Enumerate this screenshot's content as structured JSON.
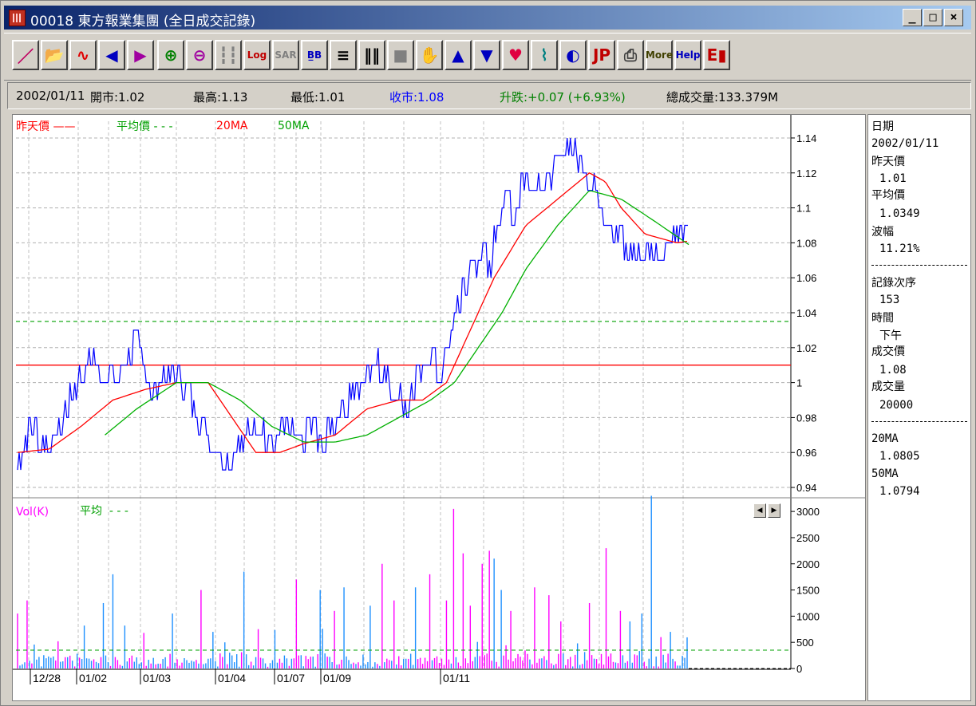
{
  "window": {
    "title": "00018 東方報業集團 (全日成交記錄)",
    "min_label": "_",
    "max_label": "□",
    "close_label": "×"
  },
  "toolbar": {
    "buttons": [
      {
        "name": "draw-line-icon",
        "glyph": "／",
        "color": "#c00060"
      },
      {
        "name": "open-folder-icon",
        "glyph": "📂",
        "color": "#c08000"
      },
      {
        "name": "wave-icon",
        "glyph": "∿",
        "color": "#e00000"
      },
      {
        "name": "arrow-left-icon",
        "glyph": "◀",
        "color": "#0000c0"
      },
      {
        "name": "arrow-right-icon",
        "glyph": "▶",
        "color": "#a000a0"
      },
      {
        "name": "zoom-in-icon",
        "glyph": "⊕",
        "color": "#008000"
      },
      {
        "name": "zoom-out-icon",
        "glyph": "⊖",
        "color": "#a000a0"
      },
      {
        "name": "candlestick-icon",
        "glyph": "┇┇",
        "color": "#808080"
      },
      {
        "name": "log-icon",
        "glyph": "Log",
        "color": "#c00000"
      },
      {
        "name": "sar-icon",
        "glyph": "SAR",
        "color": "#808080"
      },
      {
        "name": "bb-icon",
        "glyph": "B̲B",
        "color": "#0000c0"
      },
      {
        "name": "horizontal-grid-icon",
        "glyph": "≡",
        "color": "#000000"
      },
      {
        "name": "vertical-grid-icon",
        "glyph": "‖‖",
        "color": "#000000"
      },
      {
        "name": "fill-square-icon",
        "glyph": "■",
        "color": "#808080"
      },
      {
        "name": "hand-icon",
        "glyph": "✋",
        "color": "#404040"
      },
      {
        "name": "arrow-up-icon",
        "glyph": "▲",
        "color": "#0000c0"
      },
      {
        "name": "arrow-down-icon",
        "glyph": "▼",
        "color": "#0000c0"
      },
      {
        "name": "favorite-folder-icon",
        "glyph": "♥",
        "color": "#e00040"
      },
      {
        "name": "indicator-chart-icon",
        "glyph": "⌇",
        "color": "#008080"
      },
      {
        "name": "color-palette-icon",
        "glyph": "◐",
        "color": "#0000c0"
      },
      {
        "name": "save-jp-icon",
        "glyph": "JP",
        "color": "#c00000"
      },
      {
        "name": "print-icon",
        "glyph": "⎙",
        "color": "#404040"
      },
      {
        "name": "more-icon",
        "glyph": "More",
        "color": "#404000"
      },
      {
        "name": "help-icon",
        "glyph": "Help",
        "color": "#0000c0"
      },
      {
        "name": "exit-door-icon",
        "glyph": "E▮",
        "color": "#c00000"
      }
    ]
  },
  "info": {
    "date": "2002/01/11",
    "open": "開市:1.02",
    "high": "最高:1.13",
    "low": "最低:1.01",
    "close": "收市:1.08",
    "change": "升跌:+0.07 (+6.93%)",
    "volume": "總成交量:133.379M",
    "colors": {
      "close": "#0000ff",
      "change": "#008000"
    }
  },
  "legend": {
    "prev_price": "昨天價",
    "avg_price": "平均價",
    "ma20": "20MA",
    "ma50": "50MA",
    "vol_label": "Vol(K)",
    "vol_avg": "平均"
  },
  "side": {
    "date_label": "日期",
    "date_value": "2002/01/11",
    "prev_label": "昨天價",
    "prev_value": "1.01",
    "avg_label": "平均價",
    "avg_value": "1.0349",
    "amp_label": "波幅",
    "amp_value": "11.21%",
    "seq_label": "記錄次序",
    "seq_value": "153",
    "time_label": "時間",
    "time_value": "下午",
    "price_label": "成交價",
    "price_value": "1.08",
    "vol_label": "成交量",
    "vol_value": "20000",
    "ma20_label": "20MA",
    "ma20_value": "1.0805",
    "ma50_label": "50MA",
    "ma50_value": "1.0794"
  },
  "chart_data": [
    {
      "type": "line",
      "y_ticks": [
        "1.14",
        "1.12",
        "1.1",
        "1.08",
        "1.06",
        "1.04",
        "1.02",
        "1",
        "0.98",
        "0.96",
        "0.94"
      ],
      "ylim": [
        0.935,
        1.145
      ],
      "x_tick_labels": [
        "12/28",
        "01/02",
        "01/03",
        "01/04",
        "01/07",
        "01/09",
        "01/11"
      ],
      "prev_close": 1.01,
      "average": 1.035,
      "series": [
        {
          "name": "昨天價",
          "color": "#ff0000"
        },
        {
          "name": "平均價",
          "color": "#00a000"
        },
        {
          "name": "20MA",
          "color": "#ff0000"
        },
        {
          "name": "50MA",
          "color": "#00a000"
        }
      ],
      "price_keypoints": [
        [
          0,
          0.95
        ],
        [
          10,
          0.96
        ],
        [
          18,
          0.97
        ],
        [
          30,
          0.96
        ],
        [
          40,
          0.96
        ],
        [
          55,
          0.97
        ],
        [
          68,
          0.99
        ],
        [
          82,
          1.0
        ],
        [
          93,
          1.01
        ],
        [
          105,
          1.0
        ],
        [
          120,
          1.0
        ],
        [
          140,
          1.01
        ],
        [
          150,
          1.02
        ],
        [
          160,
          1.0
        ],
        [
          175,
          0.99
        ],
        [
          185,
          1.0
        ],
        [
          200,
          1.0
        ],
        [
          215,
          0.99
        ],
        [
          232,
          0.97
        ],
        [
          248,
          0.96
        ],
        [
          262,
          0.95
        ],
        [
          280,
          0.96
        ],
        [
          300,
          0.97
        ],
        [
          320,
          0.96
        ],
        [
          340,
          0.97
        ],
        [
          355,
          0.96
        ],
        [
          370,
          0.97
        ],
        [
          382,
          0.96
        ],
        [
          395,
          0.97
        ],
        [
          410,
          0.98
        ],
        [
          425,
          0.99
        ],
        [
          440,
          1.0
        ],
        [
          450,
          1.01
        ],
        [
          460,
          1.0
        ],
        [
          475,
          0.99
        ],
        [
          490,
          0.98
        ],
        [
          505,
          1.0
        ],
        [
          520,
          1.01
        ],
        [
          535,
          1.0
        ],
        [
          545,
          1.02
        ],
        [
          555,
          1.04
        ],
        [
          565,
          1.05
        ],
        [
          575,
          1.06
        ],
        [
          585,
          1.07
        ],
        [
          595,
          1.06
        ],
        [
          605,
          1.09
        ],
        [
          615,
          1.1
        ],
        [
          625,
          1.09
        ],
        [
          635,
          1.11
        ],
        [
          650,
          1.11
        ],
        [
          665,
          1.11
        ],
        [
          680,
          1.12
        ],
        [
          695,
          1.13
        ],
        [
          710,
          1.12
        ],
        [
          722,
          1.11
        ],
        [
          732,
          1.1
        ],
        [
          742,
          1.09
        ],
        [
          755,
          1.08
        ],
        [
          770,
          1.07
        ],
        [
          790,
          1.07
        ],
        [
          810,
          1.07
        ],
        [
          825,
          1.08
        ],
        [
          840,
          1.08
        ]
      ],
      "ma20_keypoints": [
        [
          0,
          0.96
        ],
        [
          40,
          0.962
        ],
        [
          80,
          0.975
        ],
        [
          120,
          0.99
        ],
        [
          160,
          0.996
        ],
        [
          200,
          1.0
        ],
        [
          240,
          1.0
        ],
        [
          270,
          0.98
        ],
        [
          300,
          0.96
        ],
        [
          330,
          0.96
        ],
        [
          360,
          0.965
        ],
        [
          400,
          0.97
        ],
        [
          440,
          0.985
        ],
        [
          480,
          0.99
        ],
        [
          510,
          0.99
        ],
        [
          540,
          1.0
        ],
        [
          570,
          1.03
        ],
        [
          600,
          1.06
        ],
        [
          640,
          1.09
        ],
        [
          680,
          1.105
        ],
        [
          720,
          1.12
        ],
        [
          740,
          1.115
        ],
        [
          760,
          1.1
        ],
        [
          790,
          1.085
        ],
        [
          830,
          1.08
        ],
        [
          845,
          1.081
        ]
      ],
      "ma50_keypoints": [
        [
          110,
          0.97
        ],
        [
          150,
          0.985
        ],
        [
          200,
          1.0
        ],
        [
          240,
          1.0
        ],
        [
          280,
          0.99
        ],
        [
          320,
          0.975
        ],
        [
          360,
          0.966
        ],
        [
          400,
          0.966
        ],
        [
          440,
          0.97
        ],
        [
          480,
          0.98
        ],
        [
          520,
          0.99
        ],
        [
          550,
          1.0
        ],
        [
          580,
          1.02
        ],
        [
          610,
          1.04
        ],
        [
          640,
          1.065
        ],
        [
          680,
          1.09
        ],
        [
          720,
          1.11
        ],
        [
          760,
          1.105
        ],
        [
          800,
          1.093
        ],
        [
          845,
          1.079
        ]
      ]
    },
    {
      "type": "bar",
      "y_ticks": [
        "3000",
        "2500",
        "2000",
        "1500",
        "1000",
        "500",
        "0"
      ],
      "ylim": [
        0,
        3200
      ],
      "average": 350,
      "series_colors": {
        "up": "#ff00ff",
        "down": "#1e90ff"
      },
      "volume_spikes": [
        [
          0,
          1050
        ],
        [
          12,
          1300
        ],
        [
          50,
          520
        ],
        [
          85,
          820
        ],
        [
          108,
          1250
        ],
        [
          120,
          1800
        ],
        [
          135,
          820
        ],
        [
          160,
          680
        ],
        [
          195,
          1050
        ],
        [
          232,
          1500
        ],
        [
          245,
          700
        ],
        [
          262,
          500
        ],
        [
          285,
          1850
        ],
        [
          302,
          1300
        ],
        [
          325,
          700
        ],
        [
          350,
          1700
        ],
        [
          380,
          1500
        ],
        [
          400,
          1100
        ],
        [
          410,
          1550
        ],
        [
          445,
          1200
        ],
        [
          460,
          2000
        ],
        [
          475,
          1300
        ],
        [
          500,
          1550
        ],
        [
          520,
          1800
        ],
        [
          540,
          1300
        ],
        [
          550,
          3050
        ],
        [
          560,
          2200
        ],
        [
          570,
          1200
        ],
        [
          585,
          2000
        ],
        [
          595,
          2250
        ],
        [
          600,
          2100
        ],
        [
          610,
          1500
        ],
        [
          620,
          1100
        ],
        [
          640,
          1200
        ],
        [
          652,
          1550
        ],
        [
          670,
          1400
        ],
        [
          685,
          900
        ],
        [
          705,
          1050
        ],
        [
          720,
          1250
        ],
        [
          742,
          2300
        ],
        [
          758,
          1100
        ],
        [
          770,
          900
        ],
        [
          785,
          1050
        ],
        [
          798,
          3300
        ],
        [
          810,
          600
        ],
        [
          822,
          700
        ]
      ]
    }
  ]
}
